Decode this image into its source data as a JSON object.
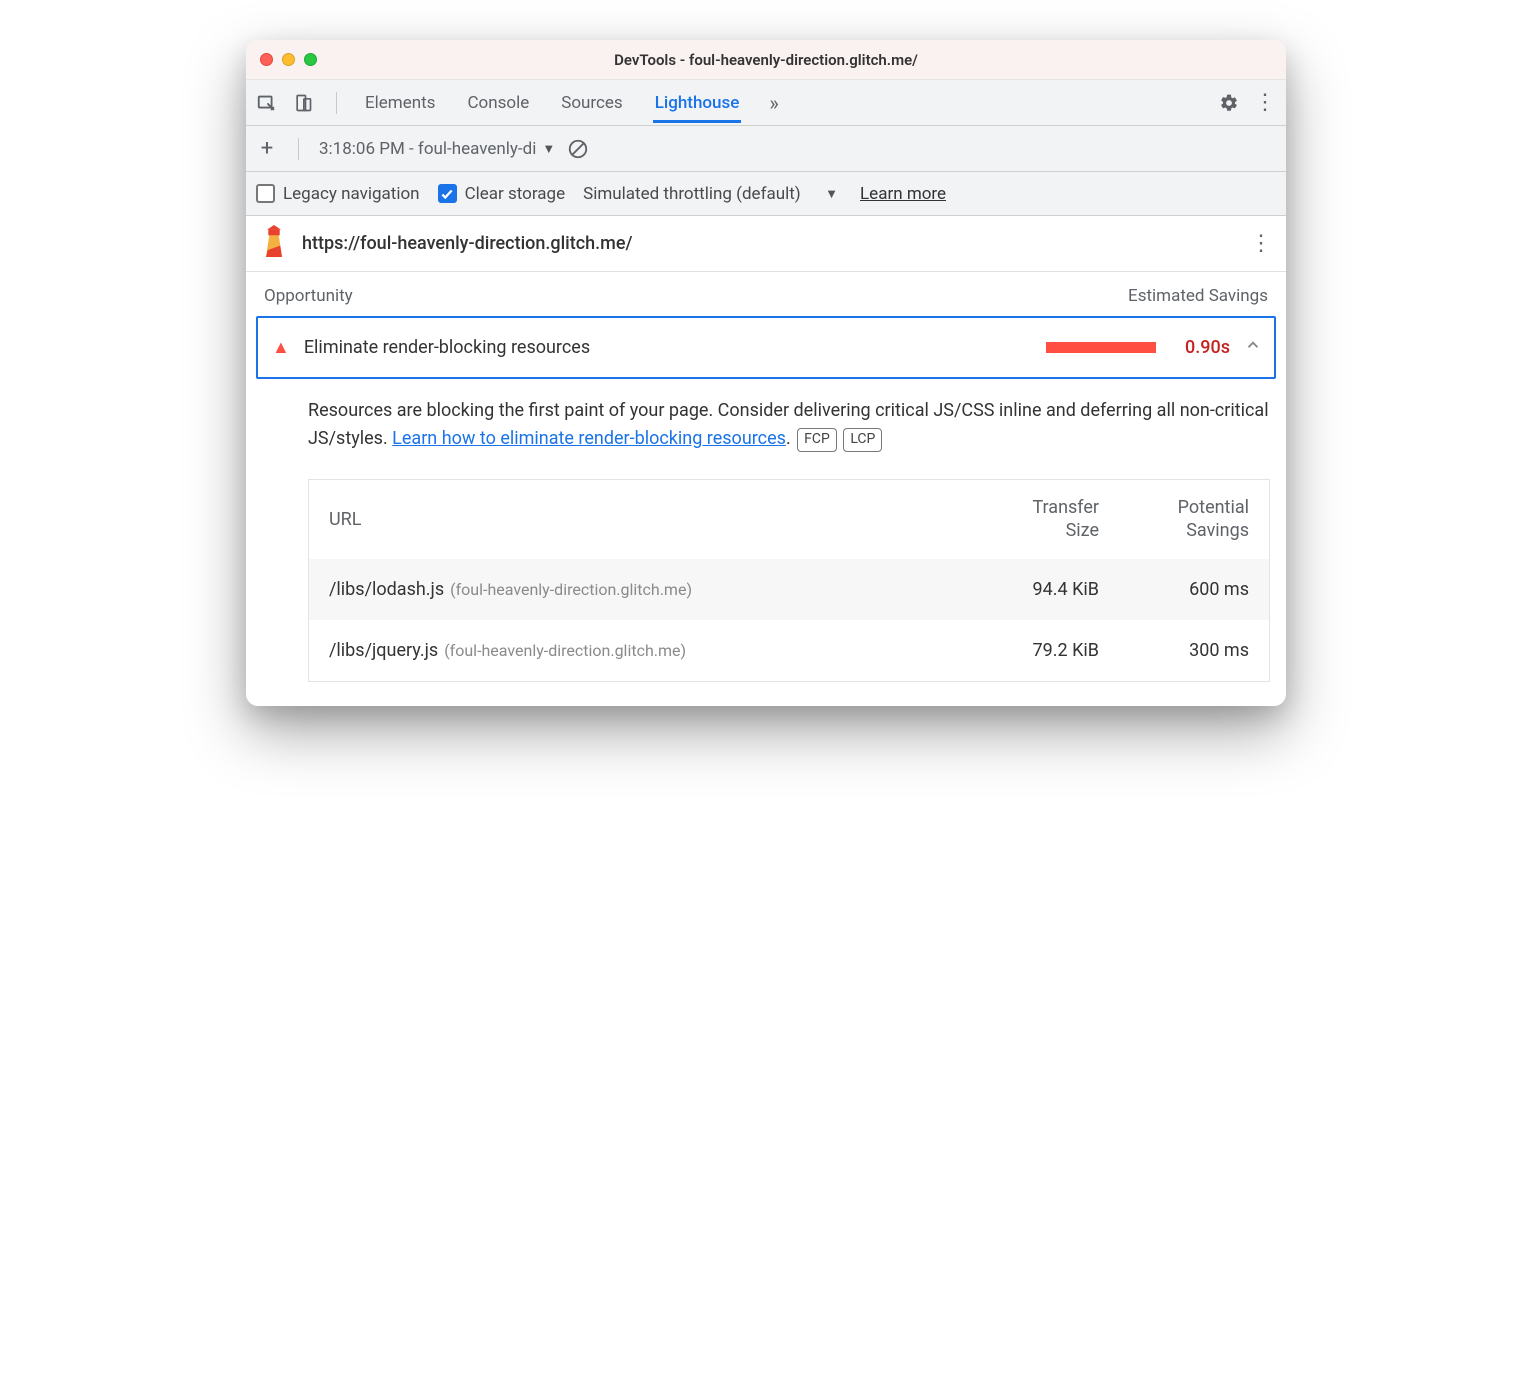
{
  "window": {
    "title": "DevTools - foul-heavenly-direction.glitch.me/"
  },
  "tabs": {
    "items": [
      "Elements",
      "Console",
      "Sources",
      "Lighthouse"
    ],
    "active_index": 3
  },
  "toolbar2": {
    "session_label": "3:18:06 PM - foul-heavenly-di"
  },
  "options": {
    "legacy_label": "Legacy navigation",
    "legacy_checked": false,
    "clear_label": "Clear storage",
    "clear_checked": true,
    "throttle_label": "Simulated throttling (default)",
    "learn_more": "Learn more"
  },
  "url_header": {
    "url": "https://foul-heavenly-direction.glitch.me/"
  },
  "opportunity": {
    "header_left": "Opportunity",
    "header_right": "Estimated Savings",
    "title": "Eliminate render-blocking resources",
    "savings_time": "0.90s",
    "desc_pre": "Resources are blocking the first paint of your page. Consider delivering critical JS/CSS inline and deferring all non-critical JS/styles. ",
    "desc_link": "Learn how to eliminate render-blocking resources",
    "desc_post": ".",
    "pills": [
      "FCP",
      "LCP"
    ],
    "table": {
      "headers": {
        "url": "URL",
        "transfer": "Transfer Size",
        "savings": "Potential Savings"
      },
      "rows": [
        {
          "path": "/libs/lodash.js",
          "host": "(foul-heavenly-direction.glitch.me)",
          "transfer": "94.4 KiB",
          "savings": "600 ms"
        },
        {
          "path": "/libs/jquery.js",
          "host": "(foul-heavenly-direction.glitch.me)",
          "transfer": "79.2 KiB",
          "savings": "300 ms"
        }
      ]
    }
  }
}
